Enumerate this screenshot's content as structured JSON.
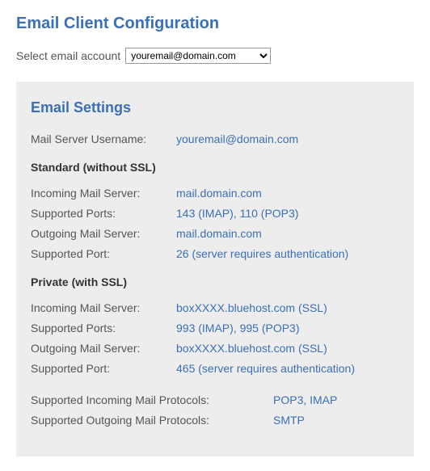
{
  "header": {
    "title": "Email Client Configuration",
    "select_label": "Select email account",
    "selected_account": "youremail@domain.com"
  },
  "settings": {
    "heading": "Email Settings",
    "username_label": "Mail Server Username:",
    "username_value": "youremail@domain.com",
    "standard": {
      "title": "Standard (without SSL)",
      "incoming_label": "Incoming Mail Server:",
      "incoming_value": "mail.domain.com",
      "ports_label": "Supported Ports:",
      "ports_value": "143 (IMAP), 110 (POP3)",
      "outgoing_label": "Outgoing Mail Server:",
      "outgoing_value": "mail.domain.com",
      "port_label": "Supported Port:",
      "port_value": "26 (server requires authentication)"
    },
    "private": {
      "title": "Private (with SSL)",
      "incoming_label": "Incoming Mail Server:",
      "incoming_value": "boxXXXX.bluehost.com (SSL)",
      "ports_label": "Supported Ports:",
      "ports_value": "993 (IMAP), 995 (POP3)",
      "outgoing_label": "Outgoing Mail Server:",
      "outgoing_value": "boxXXXX.bluehost.com (SSL)",
      "port_label": "Supported Port:",
      "port_value": "465 (server requires authentication)"
    },
    "protocols": {
      "incoming_label": "Supported Incoming Mail Protocols:",
      "incoming_value": "POP3, IMAP",
      "outgoing_label": "Supported Outgoing Mail Protocols:",
      "outgoing_value": "SMTP"
    }
  }
}
